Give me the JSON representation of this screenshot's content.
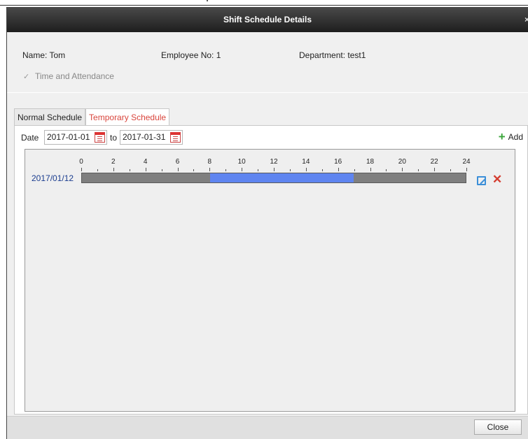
{
  "dialog": {
    "title": "Shift Schedule Details",
    "close_glyph": "×"
  },
  "info": {
    "name": "Name: Tom",
    "employee_no": "Employee No: 1",
    "department": "Department: test1",
    "checkbox_label": "Time and Attendance",
    "checkbox_glyph": "✓"
  },
  "tabs": [
    {
      "label": "Normal Schedule",
      "active": false
    },
    {
      "label": "Temporary Schedule",
      "active": true
    }
  ],
  "filter": {
    "date_label": "Date",
    "start_date": "2017-01-01",
    "to_label": "to",
    "end_date": "2017-01-31",
    "add_label": "Add",
    "add_glyph": "+"
  },
  "schedule": {
    "rows": [
      {
        "date": "2017/01/12",
        "shift_start_hour": 8,
        "shift_end_hour": 17
      }
    ],
    "hour_ticks": [
      "0",
      "2",
      "4",
      "6",
      "8",
      "10",
      "12",
      "14",
      "16",
      "18",
      "20",
      "22",
      "24"
    ],
    "delete_glyph": "✕"
  },
  "colors": {
    "shift_bar": "#5f85f0",
    "off_bar": "#7f7f7f",
    "active_tab_text": "#d9453c",
    "add_icon": "#3aa53a",
    "delete_icon": "#d43c2f",
    "edit_icon": "#3c8fd8"
  },
  "footer": {
    "close_label": "Close"
  }
}
